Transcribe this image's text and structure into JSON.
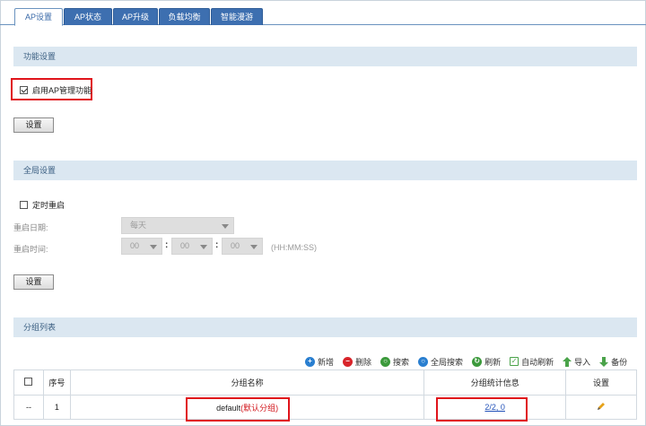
{
  "tabs": [
    {
      "label": "AP设置",
      "active": true
    },
    {
      "label": "AP状态",
      "active": false
    },
    {
      "label": "AP升级",
      "active": false
    },
    {
      "label": "负载均衡",
      "active": false
    },
    {
      "label": "智能漫游",
      "active": false
    }
  ],
  "function_section": {
    "title": "功能设置",
    "enable_label": "启用AP管理功能",
    "enable_checked": true,
    "save_label": "设置"
  },
  "global_section": {
    "title": "全局设置",
    "scheduled_reboot_label": "定时重启",
    "scheduled_reboot_checked": false,
    "reboot_date_label": "重启日期:",
    "reboot_date_value": "每天",
    "reboot_time_label": "重启时间:",
    "hour": "00",
    "minute": "00",
    "second": "00",
    "time_format": "(HH:MM:SS)",
    "colon": ":",
    "save_label": "设置"
  },
  "group_section": {
    "title": "分组列表",
    "toolbar": {
      "add": "新增",
      "delete": "删除",
      "search": "搜索",
      "global_search": "全局搜索",
      "refresh": "刷新",
      "auto_refresh": "自动刷新",
      "import": "导入",
      "backup": "备份"
    },
    "columns": {
      "index": "序号",
      "name": "分组名称",
      "stats": "分组统计信息",
      "settings": "设置"
    },
    "rows": [
      {
        "check": "--",
        "index": "1",
        "name": "default",
        "name_note": "(默认分组)",
        "stats": "2/2, 0"
      }
    ]
  },
  "colors": {
    "tab_bg": "#3d6fb0",
    "section_bg": "#dbe7f1",
    "highlight": "#e0141b",
    "link": "#2050b8"
  }
}
